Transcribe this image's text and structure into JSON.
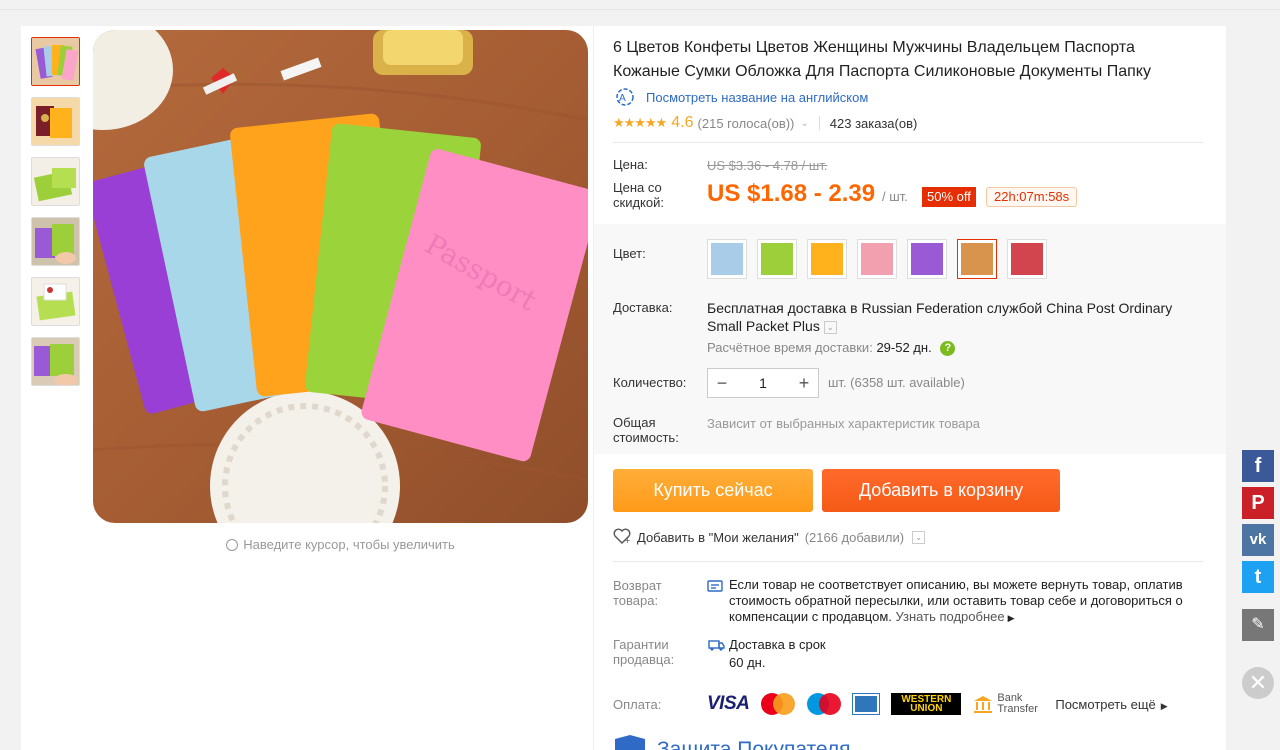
{
  "gallery": {
    "zoom_hint": "Наведите курсор, чтобы увеличить"
  },
  "product": {
    "title": "6 Цветов Конфеты Цветов Женщины Мужчины Владельцем Паспорта Кожаные Сумки Обложка Для Паспорта Силиконовые Документы Папку",
    "translate_link": "Посмотреть название на английском",
    "rating_score": "4.6",
    "rating_votes": "(215 голоса(ов))",
    "orders": "423 заказа(ов)"
  },
  "price": {
    "label": "Цена:",
    "old": "US $3.36 - 4.78 / шт.",
    "discount_label": "Цена со скидкой:",
    "current": "US $1.68 - 2.39",
    "unit": "/ шт.",
    "discount_badge": "50% off",
    "timer": "22h:07m:58s"
  },
  "color": {
    "label": "Цвет:",
    "swatches": [
      "#a9cde8",
      "#9ccf3a",
      "#ffb21c",
      "#f2a0b0",
      "#9a5ad6",
      "#d8944c",
      "#d2454f"
    ]
  },
  "shipping": {
    "label": "Доставка:",
    "line_bold": "Бесплатная доставка в",
    "line_rest": "Russian Federation службой China Post Ordinary Small Packet Plus",
    "eta_label": "Расчётное время доставки:",
    "eta_value": "29-52 дн."
  },
  "quantity": {
    "label": "Количество:",
    "value": "1",
    "info": "шт. (6358 шт. available)"
  },
  "total": {
    "label": "Общая стоимость:",
    "text": "Зависит от выбранных характеристик товара"
  },
  "actions": {
    "buy_now": "Купить сейчас",
    "add_to_cart": "Добавить в корзину",
    "wishlist": "Добавить в \"Мои желания\"",
    "wishlist_count": "(2166 добавили)"
  },
  "returns": {
    "label": "Возврат товара:",
    "text": "Если товар не соответствует описанию, вы можете вернуть товар, оплатив стоимость обратной пересылки, или оставить товар себе и договориться о компенсации с продавцом.",
    "more": "Узнать подробнее"
  },
  "guarantee": {
    "label": "Гарантии продавца:",
    "line1": "Доставка в срок",
    "line2": "60 дн."
  },
  "payment": {
    "label": "Оплата:",
    "visa": "VISA",
    "wu_top": "WESTERN",
    "wu_bottom": "UNION",
    "bank": "Bank Transfer",
    "more": "Посмотреть ещё"
  },
  "protection": {
    "title": "Защита Покупателя"
  },
  "social": {
    "facebook": "f",
    "pinterest": "P",
    "vk": "vk",
    "twitter": "t",
    "edit": "✎",
    "close": "✕"
  }
}
